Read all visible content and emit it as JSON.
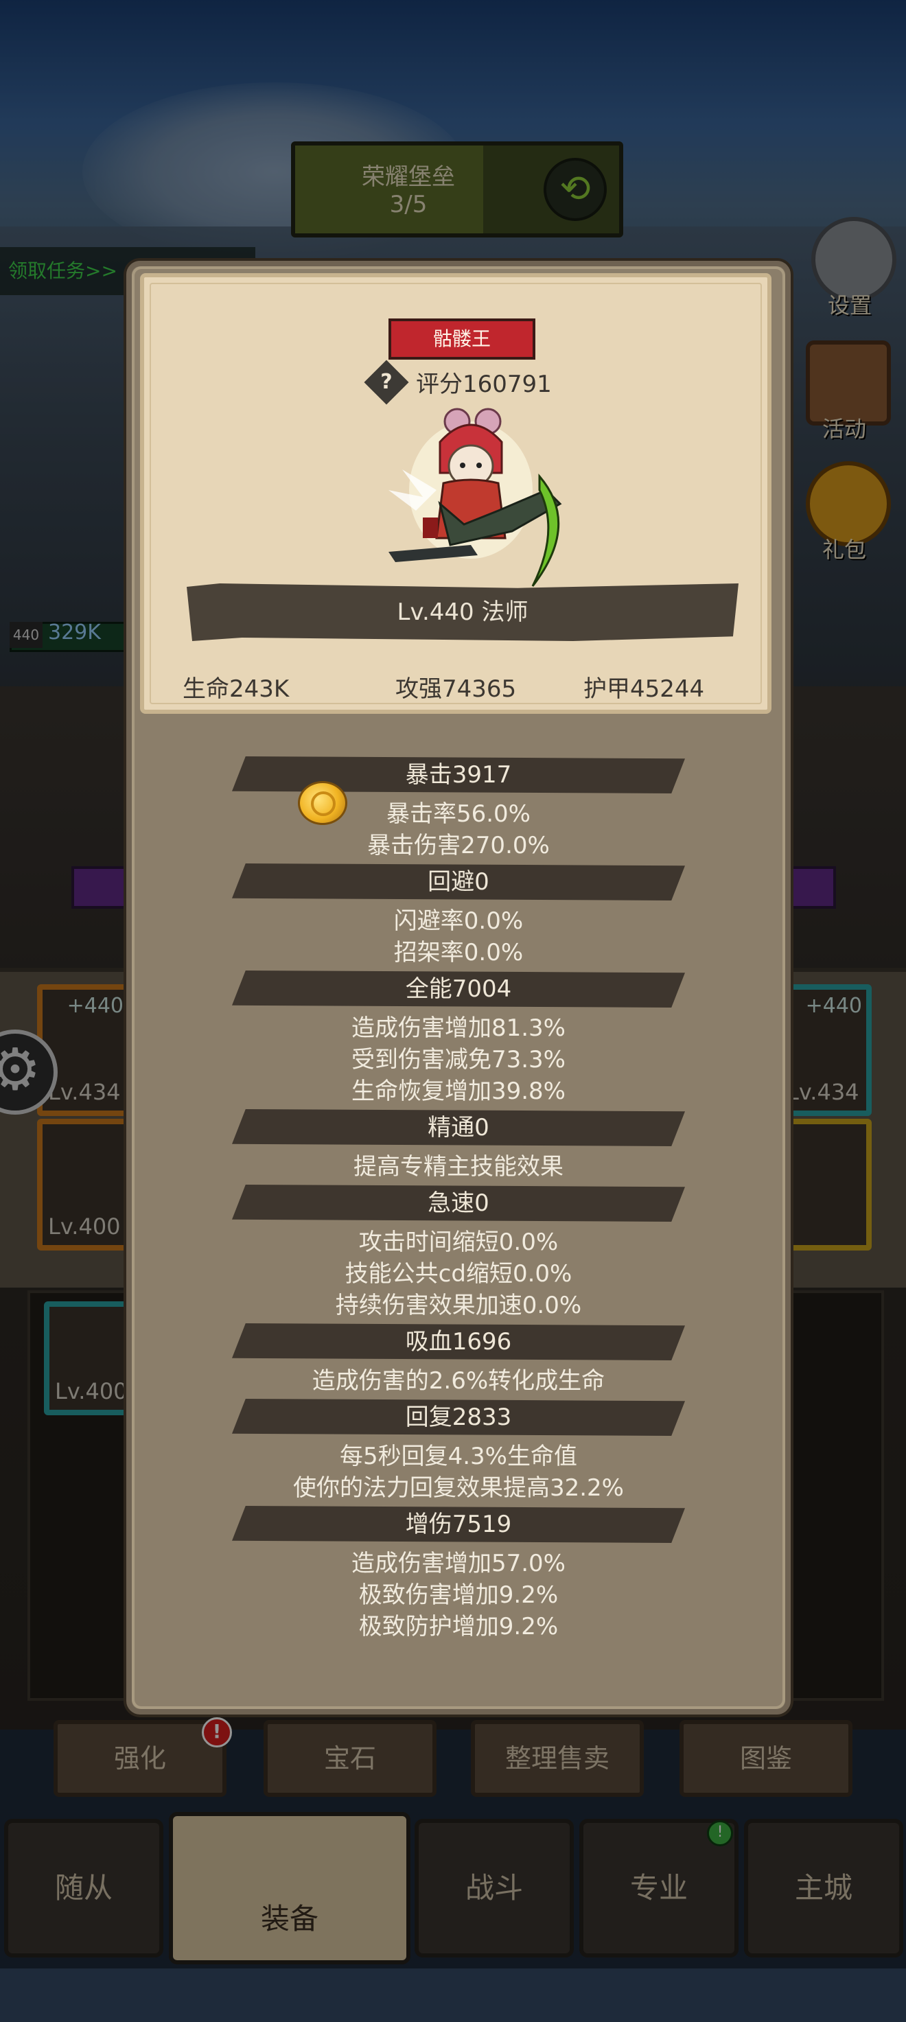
{
  "header": {
    "mission_title": "荣耀堡垒",
    "mission_progress": "3/5",
    "task_link": "领取任务>>"
  },
  "side_icons": {
    "settings": "设置",
    "events": "活动",
    "gift": "礼包"
  },
  "player_bar": {
    "level": "440",
    "hp": "329K"
  },
  "equip_slots": [
    {
      "level": "Lv.434",
      "plus": "+440"
    },
    {
      "level": "Lv.400",
      "plus": ""
    },
    {
      "level": "Lv.400",
      "plus": ""
    },
    {
      "level": "Lv.434",
      "plus": "+440"
    }
  ],
  "panel": {
    "name_tag": "骷髅王",
    "score": "评分160791",
    "level_class": "Lv.440 法师",
    "stats": {
      "hp": "生命243K",
      "attack": "攻强74365",
      "armor": "护甲45244"
    },
    "sections": [
      {
        "title": "暴击3917",
        "lines": [
          "暴击率56.0%",
          "暴击伤害270.0%"
        ]
      },
      {
        "title": "回避0",
        "lines": [
          "闪避率0.0%",
          "招架率0.0%"
        ]
      },
      {
        "title": "全能7004",
        "lines": [
          "造成伤害增加81.3%",
          "受到伤害减免73.3%",
          "生命恢复增加39.8%"
        ]
      },
      {
        "title": "精通0",
        "lines": [
          "提高专精主技能效果"
        ]
      },
      {
        "title": "急速0",
        "lines": [
          "攻击时间缩短0.0%",
          "技能公共cd缩短0.0%",
          "持续伤害效果加速0.0%"
        ]
      },
      {
        "title": "吸血1696",
        "lines": [
          "造成伤害的2.6%转化成生命"
        ]
      },
      {
        "title": "回复2833",
        "lines": [
          "每5秒回复4.3%生命值",
          "使你的法力回复效果提高32.2%"
        ]
      },
      {
        "title": "增伤7519",
        "lines": [
          "造成伤害增加57.0%",
          "极致伤害增加9.2%",
          "极致防护增加9.2%"
        ]
      }
    ]
  },
  "action_buttons": [
    "强化",
    "宝石",
    "整理售卖",
    "图鉴"
  ],
  "badges": {
    "strengthen": "!",
    "profession": "!"
  },
  "nav": [
    "随从",
    "装备",
    "战斗",
    "专业",
    "主城"
  ],
  "colors": {
    "panel_bg": "#8b7e6a",
    "card_bg": "#e7d6b7",
    "name_tag": "#c0262d",
    "task_link": "#3fd24a"
  }
}
